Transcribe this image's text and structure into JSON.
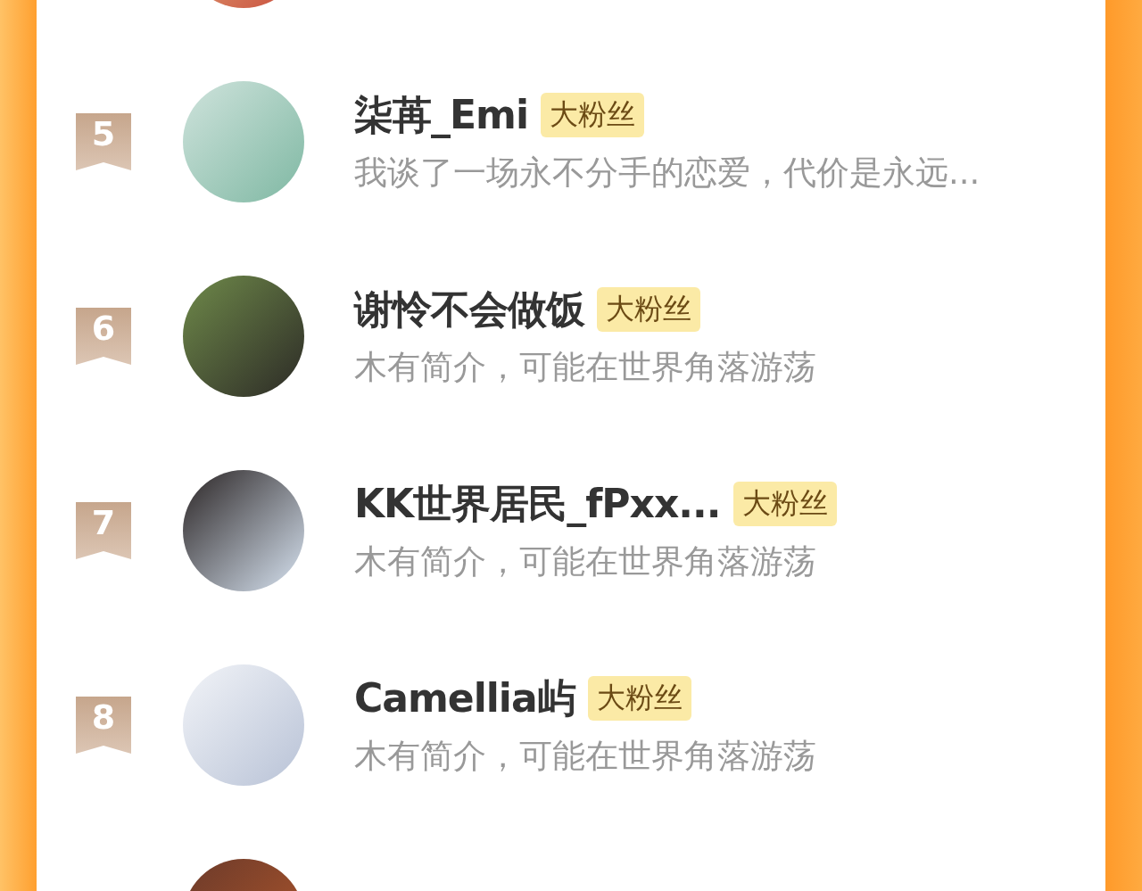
{
  "fans": [
    {
      "kind": "cut"
    },
    {
      "kind": "full",
      "rank": "5",
      "name": "柒苒_Emi",
      "tag": "大粉丝",
      "bio": "我谈了一场永不分手的恋爱，代价是永远..."
    },
    {
      "kind": "full",
      "rank": "6",
      "name": "谢怜不会做饭",
      "tag": "大粉丝",
      "bio": "木有简介，可能在世界角落游荡"
    },
    {
      "kind": "full",
      "rank": "7",
      "name": "KK世界居民_fPxx...",
      "tag": "大粉丝",
      "bio": "木有简介，可能在世界角落游荡"
    },
    {
      "kind": "full",
      "rank": "8",
      "name": "Camellia屿",
      "tag": "大粉丝",
      "bio": "木有简介，可能在世界角落游荡"
    },
    {
      "kind": "cut"
    }
  ]
}
